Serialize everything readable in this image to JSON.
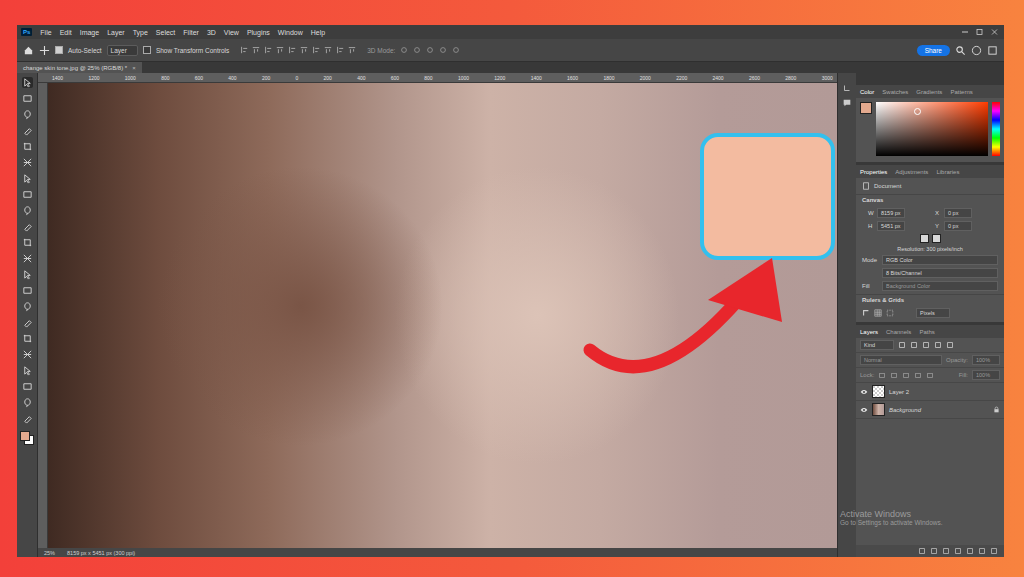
{
  "app": {
    "logo": "Ps"
  },
  "menu": [
    "File",
    "Edit",
    "Image",
    "Layer",
    "Type",
    "Select",
    "Filter",
    "3D",
    "View",
    "Plugins",
    "Window",
    "Help"
  ],
  "options_bar": {
    "auto_select": {
      "label": "Auto-Select",
      "checked": true
    },
    "target": "Layer",
    "transform": {
      "label": "Show Transform Controls",
      "checked": false
    },
    "mode_3d": "3D Mode:",
    "share": "Share"
  },
  "document_tab": {
    "title": "change skin tone.jpg @ 25% (RGB/8) *",
    "close": "×"
  },
  "ruler": {
    "ticks": [
      "1400",
      "1200",
      "1000",
      "800",
      "600",
      "400",
      "200",
      "0",
      "200",
      "400",
      "600",
      "800",
      "1000",
      "1200",
      "1400",
      "1600",
      "1800",
      "2000",
      "2200",
      "2400",
      "2600",
      "2800",
      "3000"
    ]
  },
  "tools": [
    {
      "selected": true
    },
    {
      "selected": false
    },
    {
      "selected": false
    },
    {
      "selected": false
    },
    {
      "selected": false
    },
    {
      "selected": false
    },
    {
      "selected": false
    },
    {
      "selected": false
    },
    {
      "selected": false
    },
    {
      "selected": false
    },
    {
      "selected": false
    },
    {
      "selected": false
    },
    {
      "selected": false
    },
    {
      "selected": false
    },
    {
      "selected": false
    },
    {
      "selected": false
    },
    {
      "selected": false
    },
    {
      "selected": false
    },
    {
      "selected": false
    },
    {
      "selected": false
    },
    {
      "selected": false
    },
    {
      "selected": false
    }
  ],
  "colors": {
    "foreground": "#e3a98e",
    "background": "#ffffff"
  },
  "callout": {
    "swatch_color": "#f3bba0"
  },
  "status_bar": {
    "zoom": "25%",
    "info": "8159 px x 5451 px (300 ppi)"
  },
  "color_panel": {
    "tabs": [
      {
        "label": "Color",
        "selected": true
      },
      {
        "label": "Swatches",
        "selected": false
      },
      {
        "label": "Gradients",
        "selected": false
      },
      {
        "label": "Patterns",
        "selected": false
      }
    ]
  },
  "properties_panel": {
    "tabs": [
      {
        "label": "Properties",
        "selected": true
      },
      {
        "label": "Adjustments",
        "selected": false
      },
      {
        "label": "Libraries",
        "selected": false
      }
    ],
    "section": "Document",
    "canvas_title": "Canvas",
    "fields": [
      {
        "label": "W",
        "value": "8159 px"
      },
      {
        "label": "X",
        "value": "0 px"
      },
      {
        "label": "H",
        "value": "5451 px"
      },
      {
        "label": "Y",
        "value": "0 px"
      }
    ],
    "resolution": "Resolution: 300 pixels/inch",
    "mode": {
      "label": "Mode",
      "value": "RGB Color"
    },
    "depth": "8 Bits/Channel",
    "fill": {
      "label": "Fill",
      "value": "Background Color"
    },
    "rulers": {
      "title": "Rulers & Grids",
      "unit": "Pixels"
    }
  },
  "layers_panel": {
    "tabs": [
      {
        "label": "Layers",
        "selected": true
      },
      {
        "label": "Channels",
        "selected": false
      },
      {
        "label": "Paths",
        "selected": false
      }
    ],
    "filter": "Kind",
    "blend": "Normal",
    "opacity": {
      "label": "Opacity:",
      "value": "100%"
    },
    "lock": "Lock:",
    "fill": {
      "label": "Fill:",
      "value": "100%"
    },
    "layers": [
      {
        "name": "Layer 2",
        "visible": true,
        "locked": false,
        "selected": false,
        "kind": "transparent"
      },
      {
        "name": "Background",
        "visible": true,
        "locked": true,
        "selected": false,
        "kind": "photo"
      }
    ]
  },
  "watermark": {
    "title": "Activate Windows",
    "subtitle": "Go to Settings to activate Windows."
  }
}
